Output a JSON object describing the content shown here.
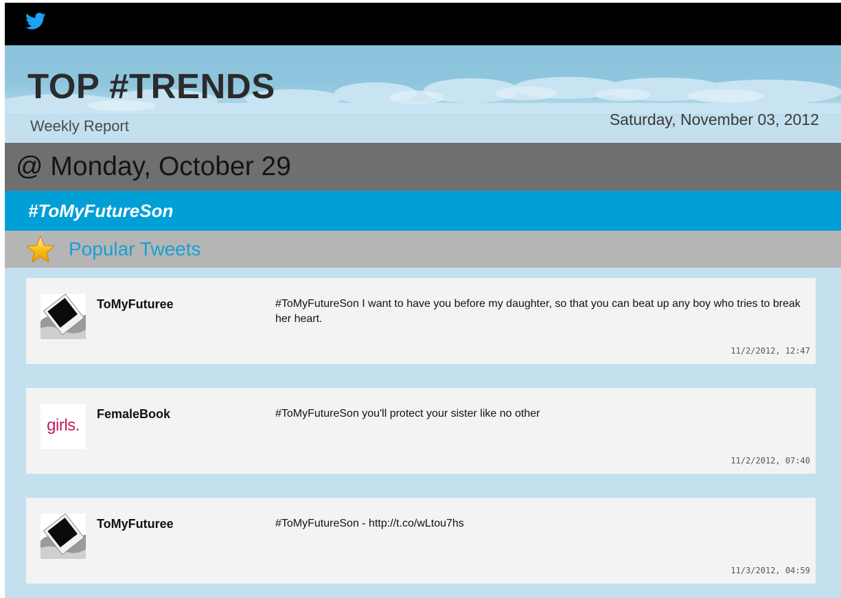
{
  "brand": {
    "icon": "twitter-bird-icon",
    "color": "#1da1f2"
  },
  "header": {
    "title": "TOP #TRENDS",
    "subtitle": "Weekly Report",
    "date": "Saturday, November 03, 2012"
  },
  "day": {
    "label": "@ Monday, October 29"
  },
  "trend": {
    "hashtag": "#ToMyFutureSon"
  },
  "popular": {
    "icon": "star-icon",
    "label": "Popular Tweets"
  },
  "tweets": [
    {
      "author": "ToMyFuturee",
      "avatar": "polaroid-photo-avatar",
      "text": "#ToMyFutureSon I want to have you before my daughter, so that you can beat up any boy who tries to break her heart.",
      "time": "11/2/2012, 12:47"
    },
    {
      "author": "FemaleBook",
      "avatar": "girls-logo-avatar",
      "avatar_text": "girls.",
      "text": "#ToMyFutureSon you'll protect your sister like no other",
      "time": "11/2/2012, 07:40"
    },
    {
      "author": "ToMyFuturee",
      "avatar": "polaroid-photo-avatar",
      "text": "#ToMyFutureSon - http://t.co/wLtou7hs",
      "time": "11/3/2012, 04:59"
    }
  ],
  "colors": {
    "topbar": "#000000",
    "sky": "#c4e0ef",
    "day_band": "#6f6f6f",
    "trend_band": "#009fd6",
    "popular_band": "#b5b5b5",
    "popular_text": "#1a9fd6",
    "card": "#f3f3f3"
  }
}
